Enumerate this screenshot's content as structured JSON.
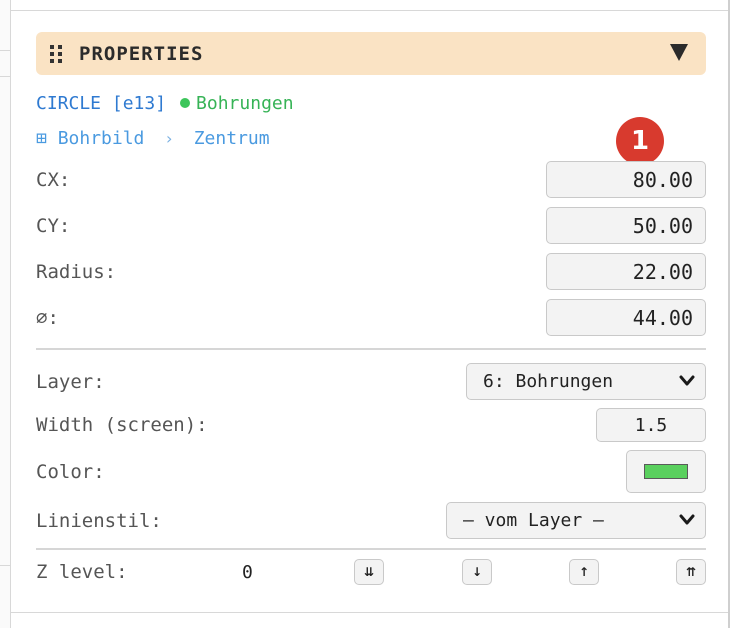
{
  "panel": {
    "title": "PROPERTIES",
    "collapse_icon": "caret-down-icon"
  },
  "entity": {
    "type_id": "CIRCLE [e13]",
    "layer_dot_color": "#3cc55a",
    "layer_name": "Bohrungen"
  },
  "breadcrumb": {
    "icon": "⊞",
    "parent": "Bohrbild",
    "separator": "›",
    "child": "Zentrum"
  },
  "badge": {
    "number": "1",
    "color": "#d83a2e"
  },
  "geometry": [
    {
      "label": "CX:",
      "value": "80.00"
    },
    {
      "label": "CY:",
      "value": "50.00"
    },
    {
      "label": "Radius:",
      "value": "22.00"
    },
    {
      "label": "⌀:",
      "value": "44.00"
    }
  ],
  "style": {
    "layer_label": "Layer:",
    "layer_value": "6: Bohrungen",
    "width_label": "Width (screen):",
    "width_value": "1.5",
    "color_label": "Color:",
    "color_value": "#5ad05e",
    "linestyle_label": "Linienstil:",
    "linestyle_value": "— vom Layer —"
  },
  "z": {
    "label": "Z level:",
    "value": "0",
    "buttons": [
      "⇊",
      "↓",
      "↑",
      "⇈"
    ]
  },
  "colors": {
    "header_bg": "#fae3c4",
    "entity_blue": "#2f7ad1",
    "breadcrumb_blue": "#4a9ae0",
    "layer_green": "#36b356"
  }
}
